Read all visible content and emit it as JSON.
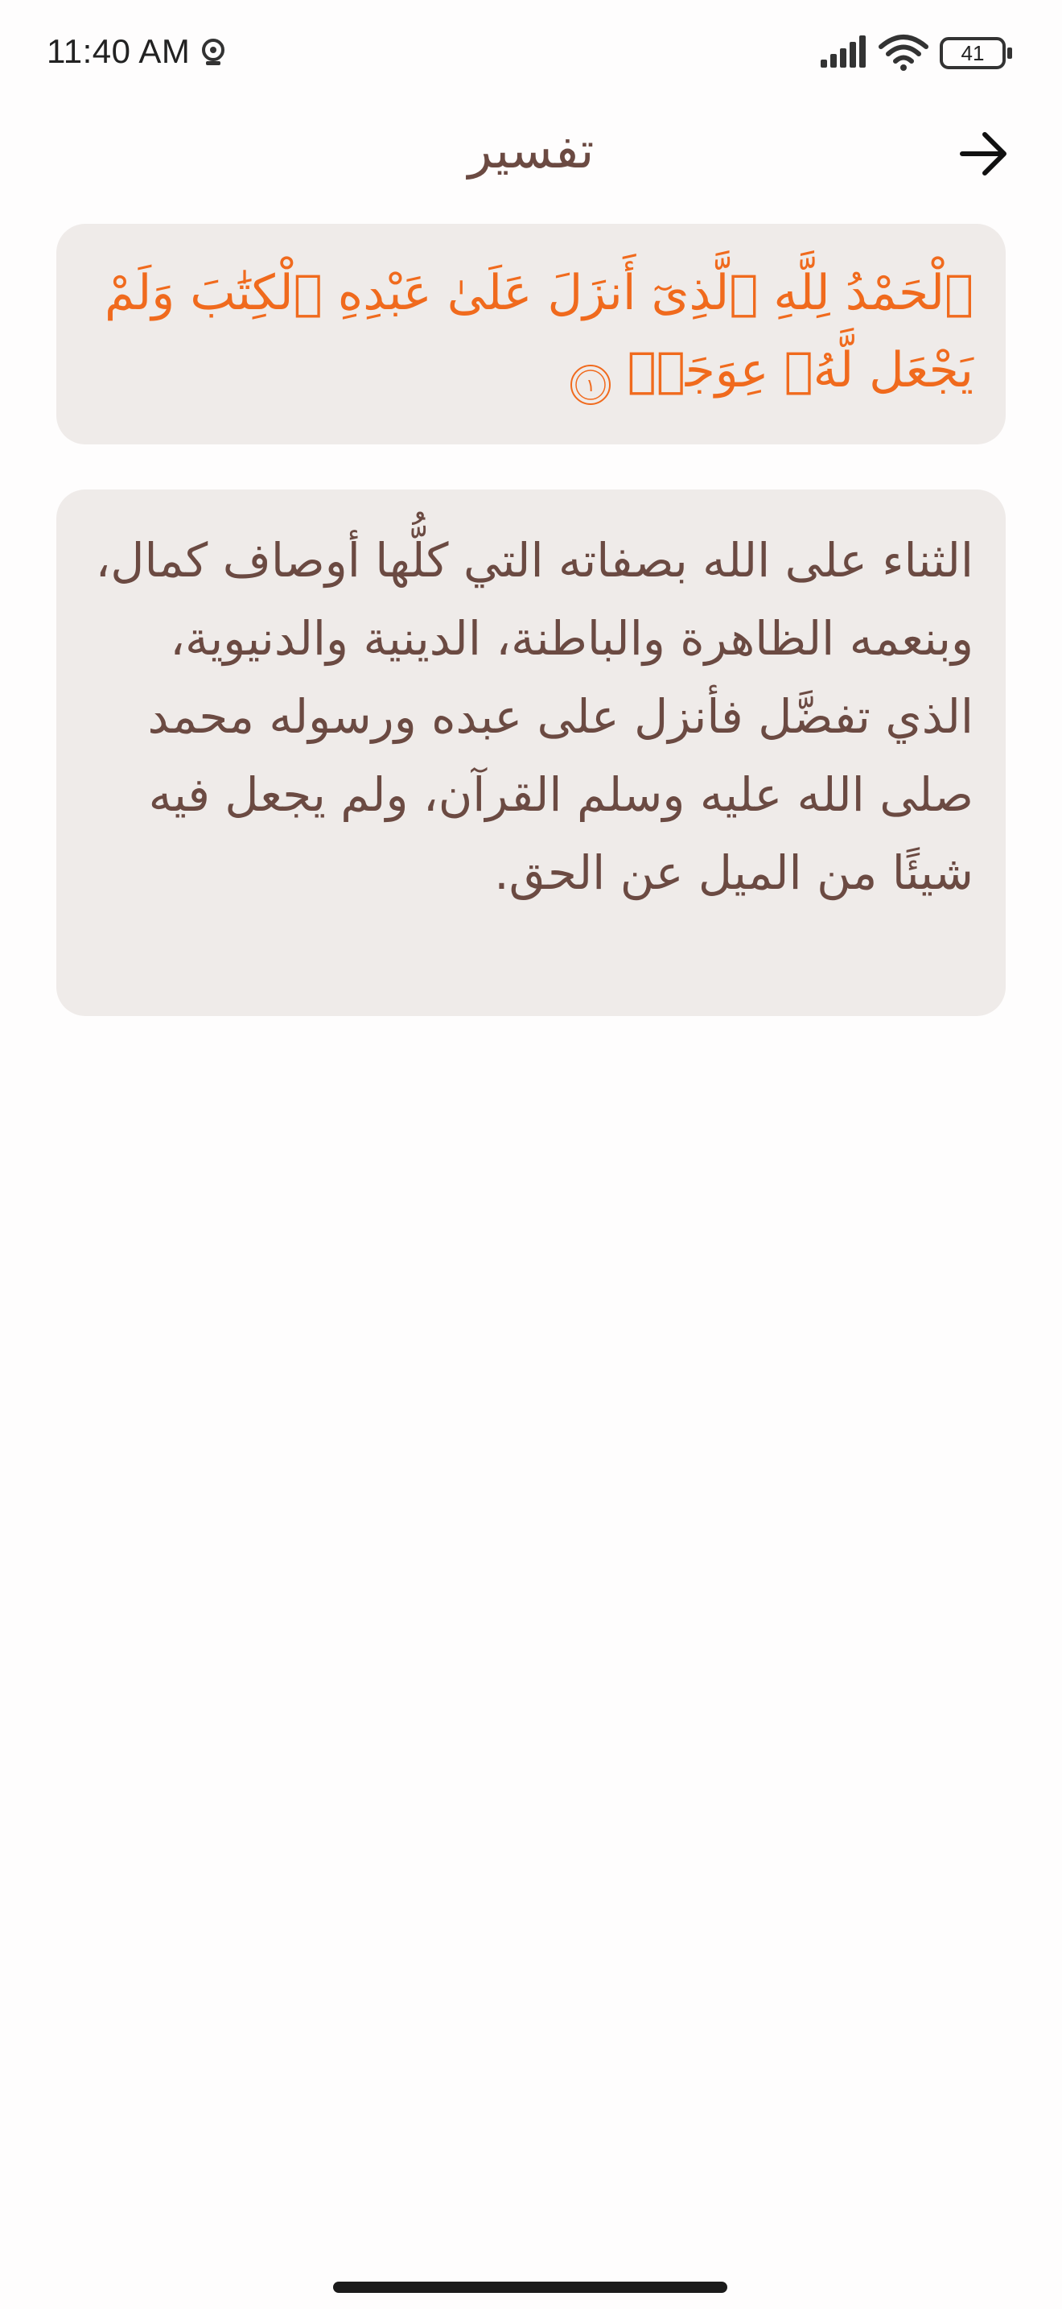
{
  "status_bar": {
    "time": "11:40 AM",
    "battery_level": "41",
    "icons": [
      "camera-status-icon",
      "signal-icon",
      "wifi-icon",
      "battery-icon"
    ]
  },
  "header": {
    "title": "تفسير",
    "back_icon": "arrow-right-icon"
  },
  "ayah": {
    "text": "ٱلْحَمْدُ لِلَّهِ ٱلَّذِىٓ أَنزَلَ عَلَىٰ عَبْدِهِ ٱلْكِتَٰبَ وَلَمْ يَجْعَل لَّهُۥ عِوَجَاۜ",
    "number": "١"
  },
  "tafsir": {
    "text": "الثناء على الله بصفاته التي كلُّها أوصاف كمال، وبنعمه الظاهرة والباطنة، الدينية والدنيوية، الذي تفضَّل فأنزل على عبده ورسوله محمد صلى الله عليه وسلم القرآن، ولم يجعل فيه شيئًا من الميل عن الحق."
  },
  "colors": {
    "accent": "#f06a1d",
    "text_brown": "#6b4a42",
    "card_bg": "#efebe9",
    "page_bg": "#fefdfd"
  }
}
